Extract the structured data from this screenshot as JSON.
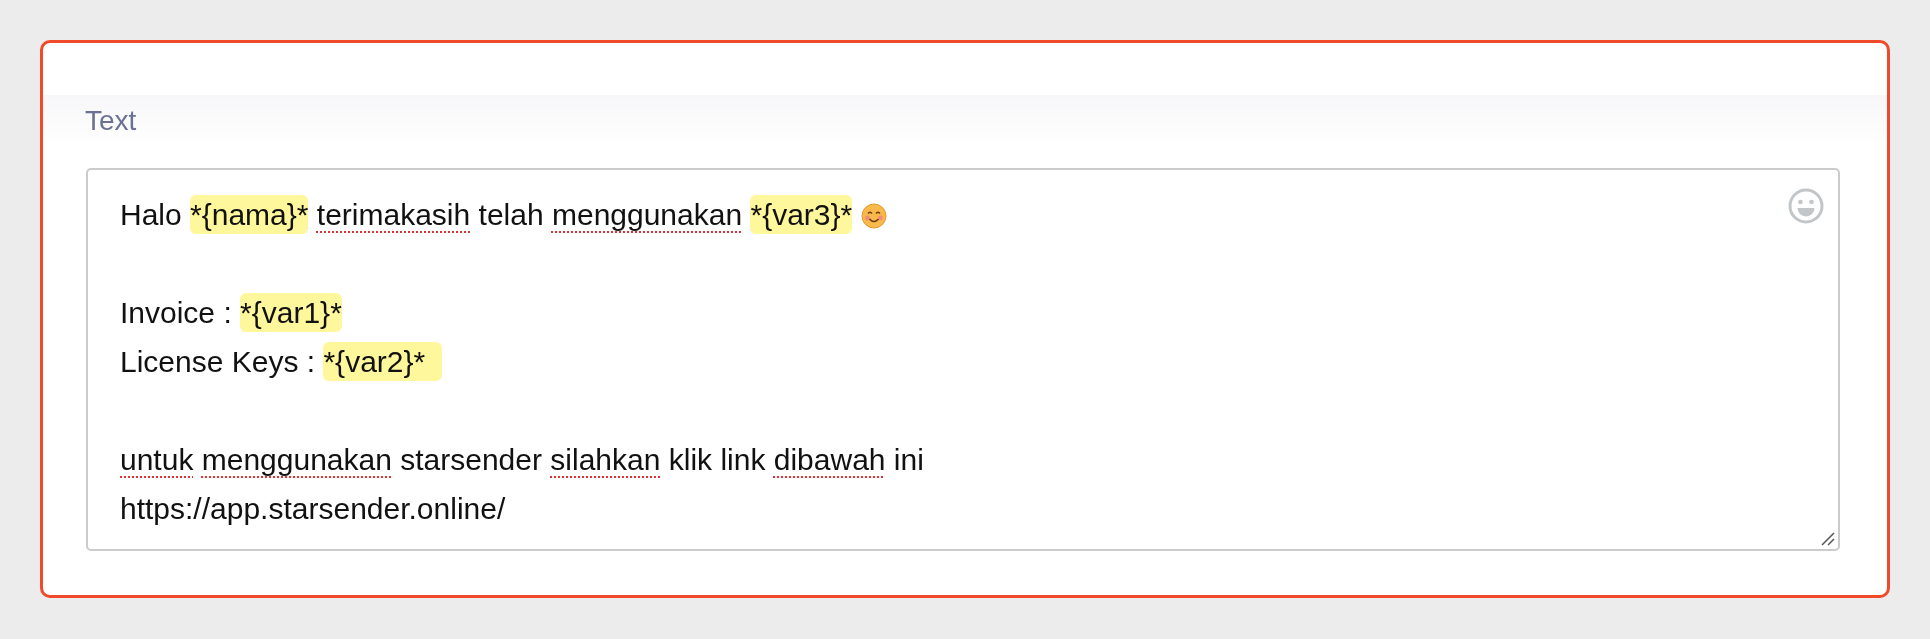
{
  "field": {
    "label": "Text",
    "lines": [
      {
        "kind": "text",
        "segments": [
          {
            "kind": "plain",
            "text": "Halo "
          },
          {
            "kind": "highlight",
            "text": "*{nama}*",
            "space_after": true
          },
          {
            "kind": "misspelled",
            "text": "terimakasih"
          },
          {
            "kind": "plain",
            "text": " telah "
          },
          {
            "kind": "misspelled",
            "text": "menggunakan",
            "space_after": true
          },
          {
            "kind": "highlight",
            "text": "*{var3}*",
            "space_after": true
          },
          {
            "kind": "emoji"
          }
        ]
      },
      {
        "kind": "blank"
      },
      {
        "kind": "text",
        "segments": [
          {
            "kind": "plain",
            "text": "Invoice : "
          },
          {
            "kind": "highlight",
            "text": "*{var1}*"
          }
        ]
      },
      {
        "kind": "text",
        "segments": [
          {
            "kind": "plain",
            "text": "License Keys : "
          },
          {
            "kind": "highlight",
            "text": "*{var2}*  "
          }
        ]
      },
      {
        "kind": "blank"
      },
      {
        "kind": "text",
        "segments": [
          {
            "kind": "misspelled",
            "text": "untuk",
            "space_after": true
          },
          {
            "kind": "misspelled",
            "text": "menggunakan"
          },
          {
            "kind": "plain",
            "text": " starsender "
          },
          {
            "kind": "misspelled",
            "text": "silahkan"
          },
          {
            "kind": "plain",
            "text": " klik link "
          },
          {
            "kind": "misspelled",
            "text": "dibawah"
          },
          {
            "kind": "plain",
            "text": " ini"
          }
        ]
      },
      {
        "kind": "text",
        "segments": [
          {
            "kind": "plain",
            "text": "https://app.starsender.online/"
          }
        ]
      }
    ]
  }
}
